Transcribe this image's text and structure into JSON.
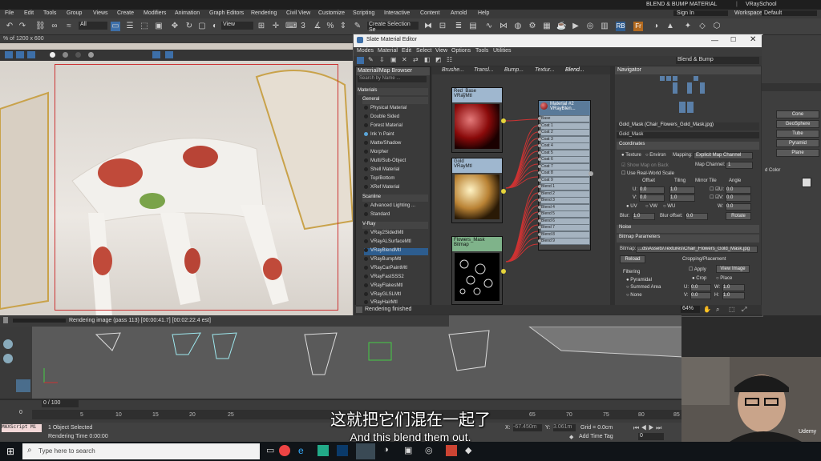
{
  "app": {
    "title": "BLEND & BUMP MATERIAL",
    "brand": "VRaySchool",
    "sign_in": "Sign In",
    "workspaces_label": "Workspaces:",
    "workspace": "Default",
    "menu": [
      "File",
      "Edit",
      "Tools",
      "Group",
      "Views",
      "Create",
      "Modifiers",
      "Animation",
      "Graph Editors",
      "Rendering",
      "Civil View",
      "Customize",
      "Scripting",
      "Interactive",
      "Content",
      "Arnold",
      "Help"
    ],
    "toolbar_filter": "All",
    "toolbar_view": "View",
    "toolbar_selection": "Create Selection Se"
  },
  "viewport": {
    "info": "% of 1200 x 600",
    "render_status": "Rendering image (pass 113) [00:00:41.7] [00:02:22.4 est]"
  },
  "sme": {
    "title": "Slate Material Editor",
    "menu": [
      "Modes",
      "Material",
      "Edit",
      "Select",
      "View",
      "Options",
      "Tools",
      "Utilities"
    ],
    "dropdown": "Blend & Bump",
    "browser_title": "Material/Map Browser",
    "search_placeholder": "Search by Name ...",
    "sections": {
      "materials": "Materials",
      "general": "General",
      "scanline": "Scanline",
      "vray": "V-Ray"
    },
    "general_items": [
      "Physical Material",
      "Double Sided",
      "Forest Material",
      "Ink 'n Paint",
      "Matte/Shadow",
      "Morpher",
      "Multi/Sub-Object",
      "Shell Material",
      "Top/Bottom",
      "XRef Material"
    ],
    "scanline_items": [
      "Advanced Lighting ...",
      "Standard"
    ],
    "vray_items": [
      "VRay2SidedMtl",
      "VRayALSurfaceMtl",
      "VRayBlendMtl",
      "VRayBumpMtl",
      "VRayCarPaintMtl",
      "VRayFastSSS2",
      "VRayFlakesMtl",
      "VRayGLSLMtl",
      "VRayHairMtl"
    ],
    "tabs": [
      "Brushe...",
      "Transl...",
      "Bump...",
      "Textur...",
      "Blend..."
    ],
    "nodes": {
      "red_base": {
        "name": "Red_Base",
        "type": "VRayMtl"
      },
      "gold": {
        "name": "Gold",
        "type": "VRayMtl"
      },
      "flowers_mask": {
        "name": "Flowers_Mask",
        "type": "Bitmap"
      },
      "blend": {
        "name": "Material #2",
        "type": "VRayBlen..."
      }
    },
    "blend_slots": [
      "Base",
      "Coat 1",
      "Coat 2",
      "Coat 3",
      "Coat 4",
      "Coat 5",
      "Coat 6",
      "Coat 7",
      "Coat 8",
      "Coat 9",
      "Blend 1",
      "Blend 2",
      "Blend 3",
      "Blend 4",
      "Blend 5",
      "Blend 6",
      "Blend 7",
      "Blend 8",
      "Blend 9"
    ],
    "navigator": "Navigator",
    "param_title": "Gold_Mask (Chair_Flowers_Gold_Mask.jpg)",
    "param_name": "Gold_Mask",
    "coordinates": {
      "title": "Coordinates",
      "texture": "Texture",
      "environ": "Environ",
      "mapping_label": "Mapping:",
      "mapping": "Explicit Map Channel",
      "show_map_on_back": "Show Map on Back",
      "map_channel_label": "Map Channel:",
      "map_channel": "1",
      "use_real_world": "Use Real-World Scale",
      "col_offset": "Offset",
      "col_tiling": "Tiling",
      "col_mirror_tile": "Mirror Tile",
      "col_angle": "Angle",
      "u_label": "U:",
      "v_label": "V:",
      "w_label": "W:",
      "u_offset": "0.0",
      "v_offset": "0.0",
      "u_tiling": "1.0",
      "v_tiling": "1.0",
      "u_angle": "0.0",
      "v_angle": "0.0",
      "w_angle": "0.0",
      "uv": "UV",
      "vw": "VW",
      "wu": "WU",
      "blur_label": "Blur:",
      "blur": "1.0",
      "blur_offset_label": "Blur offset:",
      "blur_offset": "0.0",
      "rotate": "Rotate"
    },
    "noise": "Noise",
    "bitmap_params": {
      "title": "Bitmap Parameters",
      "bitmap_label": "Bitmap:",
      "path": "...ds\\Assets\\Textures\\Chair_Flowers_Gold_Mask.jpg",
      "reload": "Reload",
      "cropping": "Cropping/Placement",
      "apply": "Apply",
      "view_image": "View Image",
      "filtering": "Filtering",
      "pyramidal": "Pyramidal",
      "summed_area": "Summed Area",
      "none": "None",
      "crop": "Crop",
      "place": "Place",
      "u": "0.0",
      "v": "0.0",
      "w": "1.0",
      "h": "1.0"
    },
    "status": "Rendering finished",
    "zoom": "64%"
  },
  "right_panel": {
    "items": [
      "Cone",
      "GeoSphere",
      "Tube",
      "Pyramid",
      "Plane"
    ],
    "color_label": "d Color"
  },
  "timeline": {
    "frame": "0 / 100",
    "ticks": [
      "0",
      "5",
      "10",
      "15",
      "20",
      "25",
      "65",
      "70",
      "75",
      "80",
      "85"
    ]
  },
  "statusbar": {
    "script": "MAXScript Mi",
    "selected": "1 Object Selected",
    "render_time": "Rendering Time  0:00:00",
    "x_label": "X:",
    "x": "-67.450m",
    "y_label": "Y:",
    "y": "3.061m",
    "grid": "Grid = 0.0cm",
    "add_time_tag": "Add Time Tag",
    "frame_field": "0"
  },
  "subtitles": {
    "chinese": "这就把它们混在一起了",
    "english": "And this blend them out."
  },
  "taskbar": {
    "search": "Type here to search"
  },
  "webcam": {
    "watermark": "Udemy"
  }
}
